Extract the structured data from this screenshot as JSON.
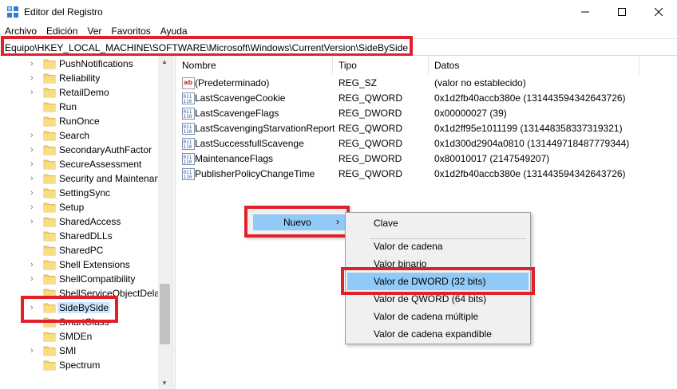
{
  "window": {
    "title": "Editor del Registro"
  },
  "menubar": {
    "items": [
      "Archivo",
      "Edición",
      "Ver",
      "Favoritos",
      "Ayuda"
    ]
  },
  "address": {
    "path": "Equipo\\HKEY_LOCAL_MACHINE\\SOFTWARE\\Microsoft\\Windows\\CurrentVersion\\SideBySide"
  },
  "tree": {
    "items": [
      {
        "label": "PushNotifications",
        "expandable": true
      },
      {
        "label": "Reliability",
        "expandable": true
      },
      {
        "label": "RetailDemo",
        "expandable": true
      },
      {
        "label": "Run",
        "expandable": false
      },
      {
        "label": "RunOnce",
        "expandable": false
      },
      {
        "label": "Search",
        "expandable": true
      },
      {
        "label": "SecondaryAuthFactor",
        "expandable": true
      },
      {
        "label": "SecureAssessment",
        "expandable": true
      },
      {
        "label": "Security and Maintenan",
        "expandable": true
      },
      {
        "label": "SettingSync",
        "expandable": true
      },
      {
        "label": "Setup",
        "expandable": true
      },
      {
        "label": "SharedAccess",
        "expandable": true
      },
      {
        "label": "SharedDLLs",
        "expandable": false
      },
      {
        "label": "SharedPC",
        "expandable": false
      },
      {
        "label": "Shell Extensions",
        "expandable": true
      },
      {
        "label": "ShellCompatibility",
        "expandable": true
      },
      {
        "label": "ShellServiceObjectDelay",
        "expandable": false
      },
      {
        "label": "SideBySide",
        "expandable": true,
        "selected": true
      },
      {
        "label": "SmartGlass",
        "expandable": false
      },
      {
        "label": "SMDEn",
        "expandable": false
      },
      {
        "label": "SMI",
        "expandable": true
      },
      {
        "label": "Spectrum",
        "expandable": false
      }
    ]
  },
  "list": {
    "columns": [
      "Nombre",
      "Tipo",
      "Datos"
    ],
    "rows": [
      {
        "icon": "string-value-icon",
        "name": "(Predeterminado)",
        "type": "REG_SZ",
        "data": "(valor no establecido)"
      },
      {
        "icon": "binary-value-icon",
        "name": "LastScavengeCookie",
        "type": "REG_QWORD",
        "data": "0x1d2fb40accb380e (131443594342643726)"
      },
      {
        "icon": "binary-value-icon",
        "name": "LastScavengeFlags",
        "type": "REG_DWORD",
        "data": "0x00000027 (39)"
      },
      {
        "icon": "binary-value-icon",
        "name": "LastScavengingStarvationReport",
        "type": "REG_QWORD",
        "data": "0x1d2ff95e1011199 (131448358337319321)"
      },
      {
        "icon": "binary-value-icon",
        "name": "LastSuccessfullScavenge",
        "type": "REG_QWORD",
        "data": "0x1d300d2904a0810 (131449718487779344)"
      },
      {
        "icon": "binary-value-icon",
        "name": "MaintenanceFlags",
        "type": "REG_DWORD",
        "data": "0x80010017 (2147549207)"
      },
      {
        "icon": "binary-value-icon",
        "name": "PublisherPolicyChangeTime",
        "type": "REG_QWORD",
        "data": "0x1d2fb40accb380e (131443594342643726)"
      }
    ]
  },
  "context_menu": {
    "parent_label": "Nuevo",
    "submenu_arrow": "›",
    "submenu": [
      "Clave",
      "Valor de cadena",
      "Valor binario",
      "Valor de DWORD (32 bits)",
      "Valor de QWORD (64 bits)",
      "Valor de cadena múltiple",
      "Valor de cadena expandible"
    ],
    "highlighted": "Valor de DWORD (32 bits)"
  },
  "colors": {
    "highlight_box": "#e0202a",
    "menu_hover": "#91c9f7",
    "folder": "#f3d06b"
  }
}
